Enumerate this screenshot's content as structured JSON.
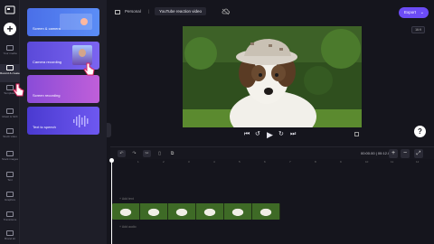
{
  "rail": {
    "items": [
      {
        "label": "Your media"
      },
      {
        "label": "Record & create"
      },
      {
        "label": "Templates"
      },
      {
        "label": "Music & SFX"
      },
      {
        "label": "Stock video"
      },
      {
        "label": "Stock images"
      },
      {
        "label": "Text"
      },
      {
        "label": "Graphics"
      },
      {
        "label": "Transitions"
      },
      {
        "label": "Brand kit"
      }
    ]
  },
  "panel": {
    "cards": [
      {
        "label": "Screen & camera"
      },
      {
        "label": "Camera recording"
      },
      {
        "label": "Screen recording"
      },
      {
        "label": "Text to speech"
      }
    ]
  },
  "header": {
    "breadcrumb_root": "Personal",
    "separator": "|",
    "project_title": "YouTube reaction video",
    "export_label": "Export",
    "ratio_label": "16:9"
  },
  "transport": {
    "rewind": "⏮",
    "back5": "↺",
    "play": "▶",
    "fwd5": "↻",
    "end": "⏭"
  },
  "help": {
    "label": "?"
  },
  "timeline": {
    "timecode": "00:00.00 | 00:12.0",
    "undo": "↶",
    "redo": "↷",
    "split": "✂",
    "zoom_in": "+",
    "zoom_out": "−",
    "fit": "⤢",
    "ruler_ticks": [
      "0",
      "1",
      "2",
      "3",
      "4",
      "5",
      "6",
      "7",
      "8",
      "9",
      "10",
      "11",
      "12"
    ],
    "add_text_label": "+ Add text",
    "add_audio_label": "+ Add audio"
  },
  "colors": {
    "accent": "#6c4cf6",
    "background": "#15151d"
  }
}
